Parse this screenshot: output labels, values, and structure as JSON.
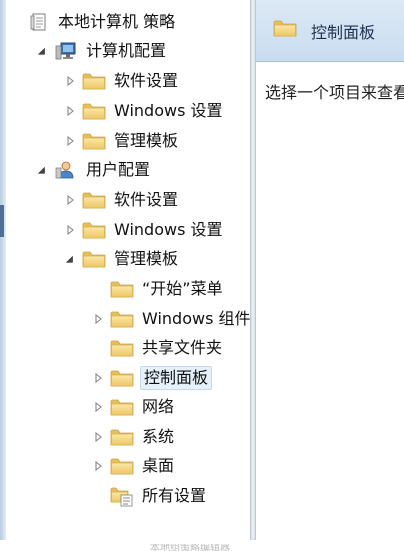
{
  "tree": {
    "root": {
      "label": "本地计算机 策略",
      "icon": "policy-document-icon"
    },
    "computer_config": {
      "label": "计算机配置",
      "icon": "computer-icon"
    },
    "computer_software": {
      "label": "软件设置",
      "icon": "folder-icon"
    },
    "computer_windows": {
      "label": "Windows 设置",
      "icon": "folder-icon"
    },
    "computer_admin": {
      "label": "管理模板",
      "icon": "folder-icon"
    },
    "user_config": {
      "label": "用户配置",
      "icon": "user-icon"
    },
    "user_software": {
      "label": "软件设置",
      "icon": "folder-icon"
    },
    "user_windows": {
      "label": "Windows 设置",
      "icon": "folder-icon"
    },
    "user_admin": {
      "label": "管理模板",
      "icon": "folder-icon"
    },
    "start_menu": {
      "label": "“开始”菜单",
      "icon": "folder-icon"
    },
    "windows_components": {
      "label": "Windows 组件",
      "icon": "folder-icon"
    },
    "shared_folders": {
      "label": "共享文件夹",
      "icon": "folder-icon"
    },
    "control_panel": {
      "label": "控制面板",
      "icon": "folder-icon",
      "selected": true
    },
    "network": {
      "label": "网络",
      "icon": "folder-icon"
    },
    "system": {
      "label": "系统",
      "icon": "folder-icon"
    },
    "desktop": {
      "label": "桌面",
      "icon": "folder-icon"
    },
    "all_settings": {
      "label": "所有设置",
      "icon": "all-settings-icon"
    }
  },
  "details": {
    "header_title": "控制面板",
    "header_icon": "folder-icon",
    "body_text": "选择一个项目来查看它的描述。"
  },
  "caption": "本地组策略编辑器",
  "colors": {
    "folder": "#f2d27a",
    "header_bg": "#d3e3f3",
    "selection": "#e5f0fb"
  }
}
